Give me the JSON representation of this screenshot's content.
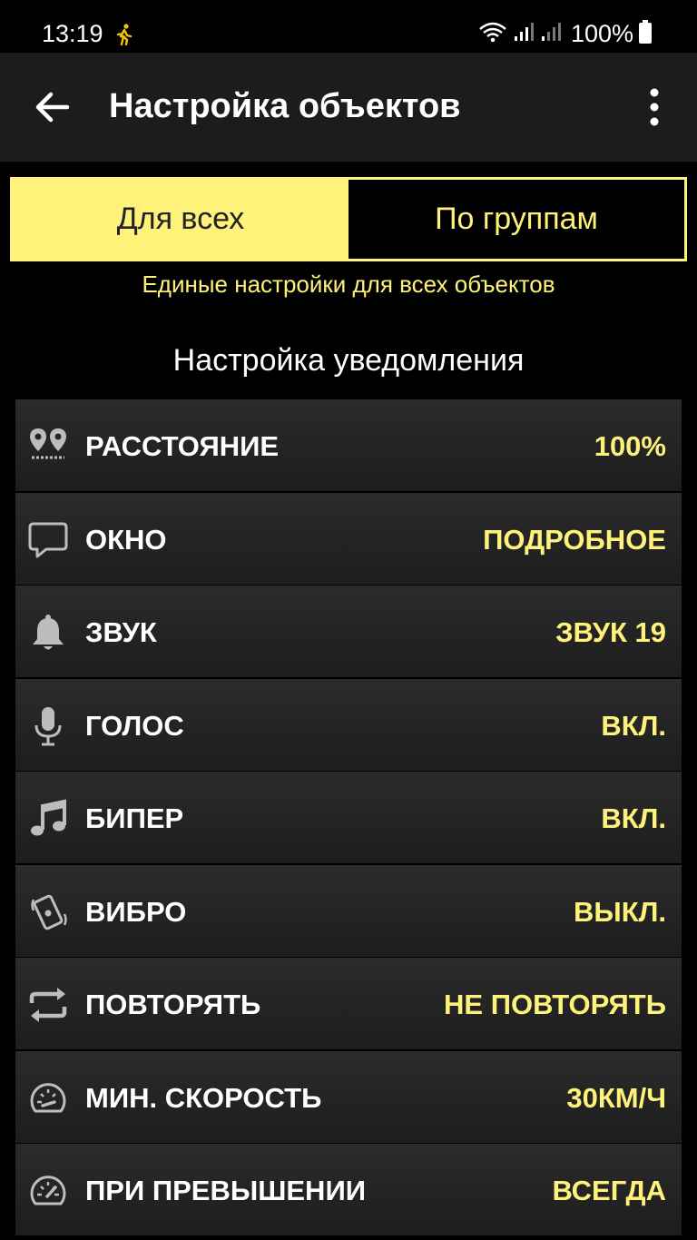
{
  "status": {
    "time": "13:19",
    "battery": "100%"
  },
  "header": {
    "title": "Настройка объектов"
  },
  "segments": {
    "all": "Для всех",
    "groups": "По группам",
    "description": "Единые настройки для всех объектов"
  },
  "section": {
    "title": "Настройка уведомления"
  },
  "settings": [
    {
      "label": "РАССТОЯНИЕ",
      "value": "100%",
      "icon": "distance-pins-icon"
    },
    {
      "label": "ОКНО",
      "value": "ПОДРОБНОЕ",
      "icon": "chat-window-icon"
    },
    {
      "label": "ЗВУК",
      "value": "ЗВУК 19",
      "icon": "bell-icon"
    },
    {
      "label": "ГОЛОС",
      "value": "ВКЛ.",
      "icon": "microphone-icon"
    },
    {
      "label": "БИПЕР",
      "value": "ВКЛ.",
      "icon": "music-note-icon"
    },
    {
      "label": "ВИБРО",
      "value": "ВЫКЛ.",
      "icon": "vibrate-phone-icon"
    },
    {
      "label": "ПОВТОРЯТЬ",
      "value": "НЕ ПОВТОРЯТЬ",
      "icon": "repeat-icon"
    },
    {
      "label": "МИН. СКОРОСТЬ",
      "value": "30КМ/Ч",
      "icon": "speedometer-icon"
    },
    {
      "label": "ПРИ ПРЕВЫШЕНИИ",
      "value": "ВСЕГДА",
      "icon": "speedometer-icon"
    }
  ],
  "colors": {
    "accent": "#fff27a",
    "row": "#2b2b2b",
    "appbar": "#1c1c1c"
  }
}
